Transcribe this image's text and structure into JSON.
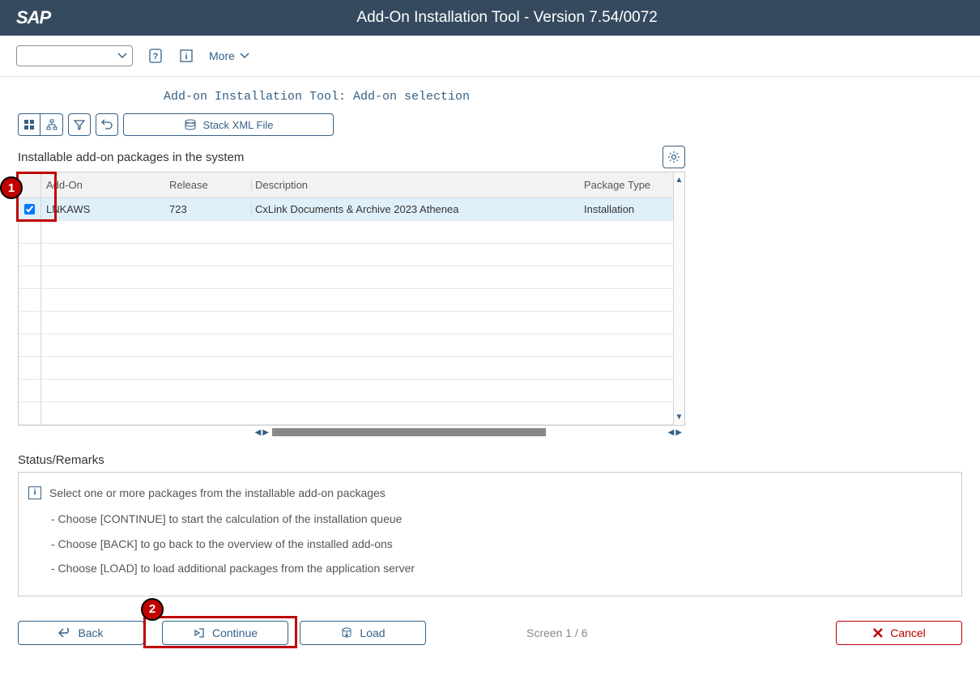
{
  "header": {
    "logo": "SAP",
    "title": "Add-On Installation Tool - Version 7.54/0072"
  },
  "toolbar": {
    "more_label": "More"
  },
  "section_title": "Add-on Installation Tool: Add-on selection",
  "buttons": {
    "stack_xml": "Stack XML File"
  },
  "table": {
    "title": "Installable add-on packages in the system",
    "columns": {
      "addon": "Add-On",
      "release": "Release",
      "description": "Description",
      "package_type": "Package Type"
    },
    "rows": [
      {
        "checked": true,
        "addon": "LNKAWS",
        "release": "723",
        "description": "CxLink Documents & Archive 2023 Athenea",
        "package_type": "Installation"
      }
    ]
  },
  "status": {
    "title": "Status/Remarks",
    "line1": "Select one or more packages from the installable add-on packages",
    "line2": "- Choose [CONTINUE] to start the calculation of the installation queue",
    "line3": "- Choose [BACK] to go back to the overview of the installed add-ons",
    "line4": "- Choose [LOAD] to load additional packages from the application server"
  },
  "footer": {
    "back": "Back",
    "continue": "Continue",
    "load": "Load",
    "cancel": "Cancel",
    "screen": "Screen 1 / 6"
  },
  "annotations": {
    "a1": "1",
    "a2": "2"
  }
}
